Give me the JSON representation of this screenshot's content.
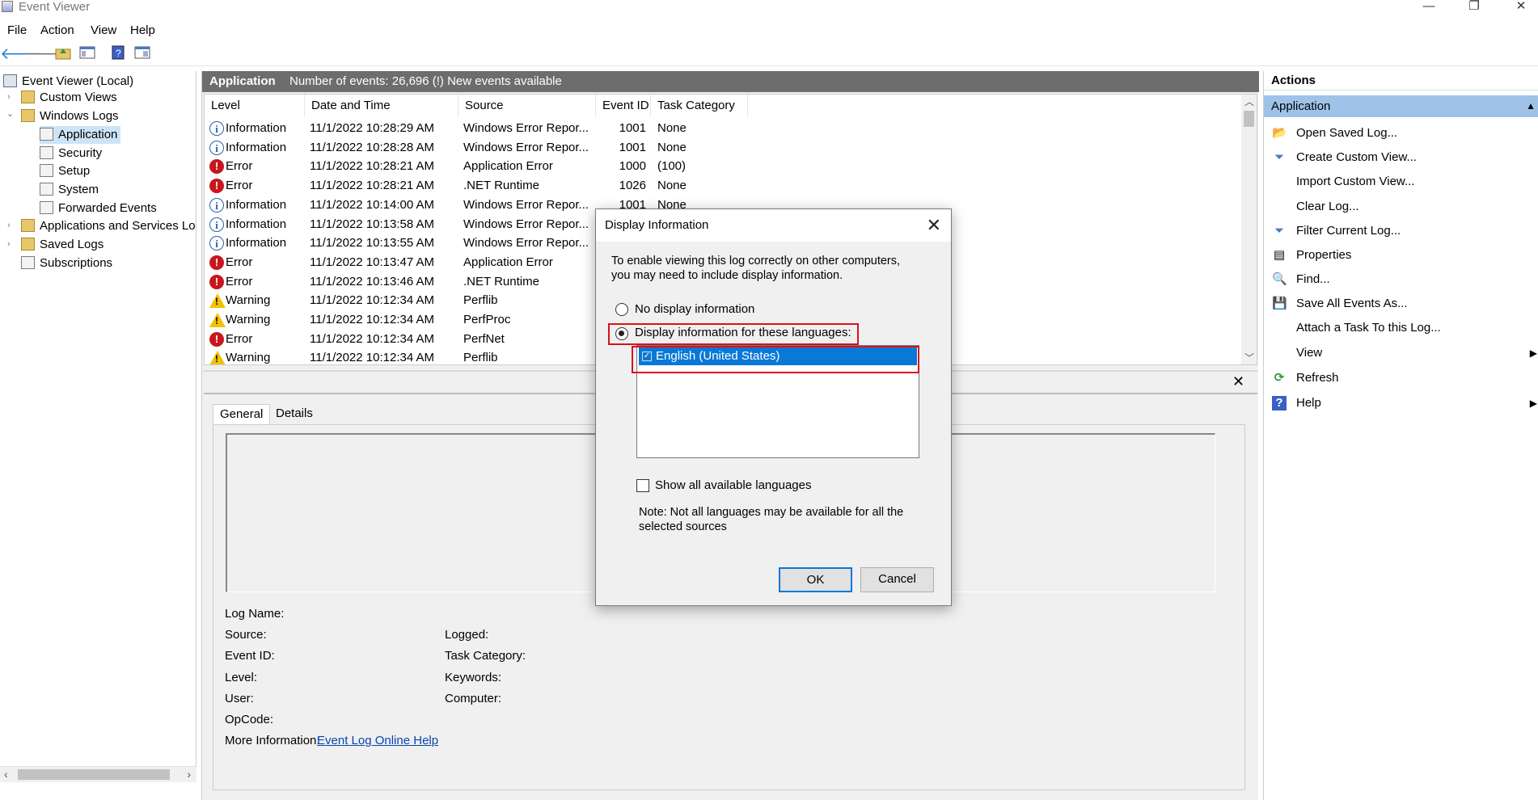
{
  "window": {
    "title": "Event Viewer",
    "minimize": "—",
    "restore": "❐",
    "close": "✕"
  },
  "menu": [
    "File",
    "Action",
    "View",
    "Help"
  ],
  "tree": {
    "root": "Event Viewer (Local)",
    "custom_views": "Custom Views",
    "windows_logs": "Windows Logs",
    "application": "Application",
    "security": "Security",
    "setup": "Setup",
    "system": "System",
    "forwarded": "Forwarded Events",
    "apps_services": "Applications and Services Log",
    "saved_logs": "Saved Logs",
    "subscriptions": "Subscriptions"
  },
  "center": {
    "log_name": "Application",
    "summary": "Number of events: 26,696 (!) New events available",
    "columns": [
      "Level",
      "Date and Time",
      "Source",
      "Event ID",
      "Task Category"
    ],
    "rows": [
      {
        "level": "Information",
        "date": "11/1/2022 10:28:29 AM",
        "source": "Windows Error Repor...",
        "id": "1001",
        "task": "None",
        "kind": "info"
      },
      {
        "level": "Information",
        "date": "11/1/2022 10:28:28 AM",
        "source": "Windows Error Repor...",
        "id": "1001",
        "task": "None",
        "kind": "info"
      },
      {
        "level": "Error",
        "date": "11/1/2022 10:28:21 AM",
        "source": "Application Error",
        "id": "1000",
        "task": "(100)",
        "kind": "error"
      },
      {
        "level": "Error",
        "date": "11/1/2022 10:28:21 AM",
        "source": ".NET Runtime",
        "id": "1026",
        "task": "None",
        "kind": "error"
      },
      {
        "level": "Information",
        "date": "11/1/2022 10:14:00 AM",
        "source": "Windows Error Repor...",
        "id": "1001",
        "task": "None",
        "kind": "info"
      },
      {
        "level": "Information",
        "date": "11/1/2022 10:13:58 AM",
        "source": "Windows Error Repor...",
        "id": "",
        "task": "",
        "kind": "info"
      },
      {
        "level": "Information",
        "date": "11/1/2022 10:13:55 AM",
        "source": "Windows Error Repor...",
        "id": "",
        "task": "",
        "kind": "info"
      },
      {
        "level": "Error",
        "date": "11/1/2022 10:13:47 AM",
        "source": "Application Error",
        "id": "",
        "task": "",
        "kind": "error"
      },
      {
        "level": "Error",
        "date": "11/1/2022 10:13:46 AM",
        "source": ".NET Runtime",
        "id": "",
        "task": "",
        "kind": "error"
      },
      {
        "level": "Warning",
        "date": "11/1/2022 10:12:34 AM",
        "source": "Perflib",
        "id": "",
        "task": "",
        "kind": "warning"
      },
      {
        "level": "Warning",
        "date": "11/1/2022 10:12:34 AM",
        "source": "PerfProc",
        "id": "",
        "task": "",
        "kind": "warning"
      },
      {
        "level": "Error",
        "date": "11/1/2022 10:12:34 AM",
        "source": "PerfNet",
        "id": "",
        "task": "",
        "kind": "error"
      },
      {
        "level": "Warning",
        "date": "11/1/2022 10:12:34 AM",
        "source": "Perflib",
        "id": "",
        "task": "",
        "kind": "warning"
      }
    ],
    "detail_close": "✕",
    "tabs": [
      "General",
      "Details"
    ],
    "fields": {
      "log_name": "Log Name:",
      "source": "Source:",
      "event_id": "Event ID:",
      "level": "Level:",
      "user": "User:",
      "opcode": "OpCode:",
      "more_info": "More Information:",
      "logged": "Logged:",
      "task_category": "Task Category:",
      "keywords": "Keywords:",
      "computer": "Computer:",
      "help_link": "Event Log Online Help"
    }
  },
  "actions": {
    "header": "Actions",
    "section": "Application",
    "items": [
      {
        "label": "Open Saved Log...",
        "icon": "open-folder-icon",
        "glyph": "📂"
      },
      {
        "label": "Create Custom View...",
        "icon": "filter-icon",
        "glyph": "⏷"
      },
      {
        "label": "Import Custom View...",
        "icon": "",
        "glyph": ""
      },
      {
        "label": "Clear Log...",
        "icon": "",
        "glyph": ""
      },
      {
        "label": "Filter Current Log...",
        "icon": "filter-icon",
        "glyph": "⏷"
      },
      {
        "label": "Properties",
        "icon": "properties-icon",
        "glyph": "▤"
      },
      {
        "label": "Find...",
        "icon": "find-icon",
        "glyph": "🔍"
      },
      {
        "label": "Save All Events As...",
        "icon": "save-icon",
        "glyph": "💾"
      },
      {
        "label": "Attach a Task To this Log...",
        "icon": "",
        "glyph": ""
      },
      {
        "label": "View",
        "icon": "",
        "glyph": ""
      },
      {
        "label": "Refresh",
        "icon": "refresh-icon",
        "glyph": "⟳"
      },
      {
        "label": "Help",
        "icon": "help-icon",
        "glyph": "?"
      }
    ]
  },
  "dialog": {
    "title": "Display Information",
    "intro_line1": "To enable viewing this log correctly on other computers,",
    "intro_line2": "you may need to include display information.",
    "option_none": "No display information",
    "option_langs": "Display information for these languages:",
    "language": "English (United States)",
    "show_all": "Show all available languages",
    "note_line1": "Note: Not all languages may be available for all the",
    "note_line2": "selected sources",
    "ok": "OK",
    "cancel": "Cancel"
  },
  "colors": {
    "header_gray": "#6d6d6d",
    "selection_blue": "#0a78d7",
    "highlight_red": "#d8121b",
    "actions_section": "#9fc3e8"
  }
}
